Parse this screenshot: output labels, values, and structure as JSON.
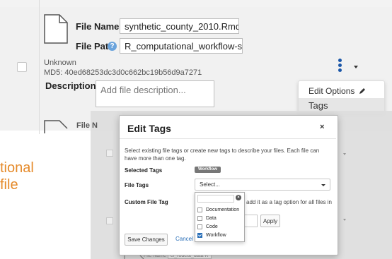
{
  "file": {
    "name_label": "File Name",
    "name_value": "synthetic_county_2010.Rmd",
    "path_label": "File Path",
    "path_value": "R_computational_workflow-samp",
    "status": "Unknown",
    "md5": "MD5: 40ed68253dc3d0c662bc19b56d9a7271",
    "description_label": "Description",
    "description_placeholder": "Add file description..."
  },
  "options_menu": {
    "edit_options": "Edit Options",
    "tags": "Tags"
  },
  "background_text": {
    "line1": "tional",
    "line2": "file",
    "ghost_file_label": "File N",
    "ghost_bottom": "File Name    ",
    "ghost_bottom_value": "cf_rodeut_data R"
  },
  "modal": {
    "title": "Edit Tags",
    "close": "×",
    "intro": "Select existing file tags or create new tags to describe your files. Each file can have more than one tag.",
    "selected_tags_label": "Selected Tags",
    "selected_tag": "Workflow",
    "file_tags_label": "File Tags",
    "select_placeholder": "Select...",
    "custom_file_tag_label": "Custom File Tag",
    "custom_hint_line1": "add it as a tag option for all files in",
    "custom_hint_line2": "",
    "apply_label": "Apply",
    "save_label": "Save Changes",
    "cancel_label": "Cancel"
  },
  "dropdown": {
    "options": [
      {
        "label": "Documentation",
        "checked": false
      },
      {
        "label": "Data",
        "checked": false
      },
      {
        "label": "Code",
        "checked": false
      },
      {
        "label": "Workflow",
        "checked": true
      }
    ]
  },
  "colors": {
    "accent": "#2a6fb8",
    "orange": "#e58a2a",
    "row_bg": "#f1f1f1"
  }
}
